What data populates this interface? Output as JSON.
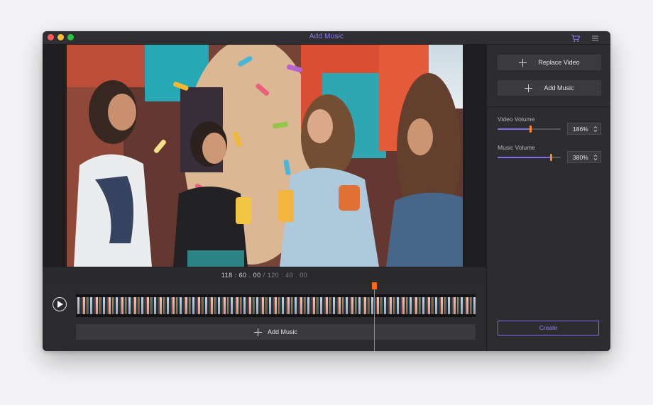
{
  "window": {
    "title": "Add Music",
    "icons": [
      "cart-icon",
      "menu-icon"
    ]
  },
  "preview": {
    "current_time": "118 : 60 . 00",
    "separator": "/",
    "total_time": "120 : 40 . 00"
  },
  "timeline": {
    "add_music_label": "Add Music",
    "playhead_progress": 0.746
  },
  "sidebar": {
    "replace_video_label": "Replace Video",
    "add_music_label": "Add Music",
    "video_volume": {
      "label": "Video Volume",
      "value": "186%",
      "level": 0.52
    },
    "music_volume": {
      "label": "Music Volume",
      "value": "380%",
      "level": 0.84
    },
    "create_label": "Create"
  },
  "colors": {
    "accent": "#7e6ff0",
    "playhead": "#ff6a1a",
    "slider_knob": "#ff8a1e"
  }
}
